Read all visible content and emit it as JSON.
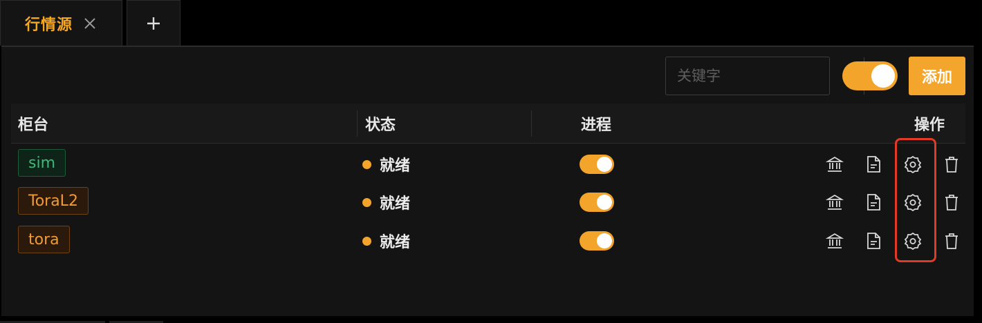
{
  "tabs": [
    {
      "label": "行情源",
      "active": true
    },
    {
      "label": "+",
      "active": false
    }
  ],
  "toolbar": {
    "search_placeholder": "关键字",
    "search_value": "",
    "toggle_on": true,
    "add_label": "添加"
  },
  "table": {
    "columns": [
      "柜台",
      "状态",
      "进程",
      "操作"
    ],
    "rows": [
      {
        "counter": "sim",
        "tag_color": "green",
        "status": "就绪",
        "process_on": true
      },
      {
        "counter": "ToraL2",
        "tag_color": "orange",
        "status": "就绪",
        "process_on": true
      },
      {
        "counter": "tora",
        "tag_color": "orange",
        "status": "就绪",
        "process_on": true
      }
    ],
    "actions": [
      "bank-icon",
      "file-icon",
      "settings-icon",
      "trash-icon"
    ]
  },
  "colors": {
    "accent": "#f3a52b",
    "highlight": "#e23a24",
    "tag_green": "#3dba7a",
    "tag_orange": "#f29a33"
  }
}
